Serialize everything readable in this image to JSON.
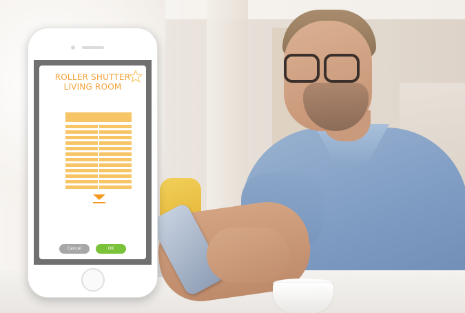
{
  "app": {
    "title_line1": "ROLLER SHUTTER",
    "title_line2": "LIVING ROOM",
    "favorite_icon": "star-outline-icon",
    "control_icon": "down-arrow-icon",
    "cancel_label": "Cancel",
    "ok_label": "OK"
  },
  "colors": {
    "accent": "#f3a23a",
    "shutter": "#f7c466",
    "ok_button": "#7bc23b",
    "cancel_button": "#a7a7a7"
  }
}
